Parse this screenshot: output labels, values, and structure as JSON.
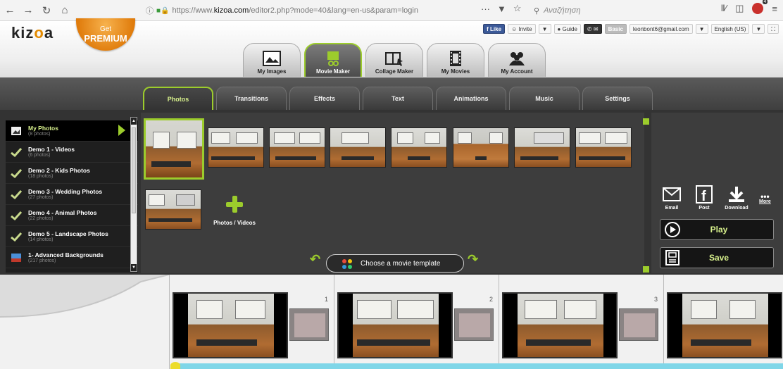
{
  "browser": {
    "url_prefix": "https://www.",
    "url_host": "kizoa.com",
    "url_path": "/editor2.php?mode=40&lang=en-us&param=login",
    "search_placeholder": "Αναζήτηση",
    "more_label": "···"
  },
  "header": {
    "logo_text_1": "kiz",
    "logo_text_2": "o",
    "logo_text_3": "a",
    "premium_line1": "Get",
    "premium_line2": "PREMIUM",
    "social": {
      "like": "Like",
      "invite": "Invite",
      "guide": "Guide",
      "plan": "Basic",
      "email": "leonbont6@gmail.com",
      "language": "English (US)"
    },
    "main_tabs": [
      {
        "label": "My Images"
      },
      {
        "label": "Movie Maker"
      },
      {
        "label": "Collage Maker"
      },
      {
        "label": "My Movies"
      },
      {
        "label": "My Account"
      }
    ]
  },
  "sub_tabs": [
    "Photos",
    "Transitions",
    "Effects",
    "Text",
    "Animations",
    "Music",
    "Settings"
  ],
  "albums": [
    {
      "name": "My Photos",
      "count": "(8 photos)"
    },
    {
      "name": "Demo 1 - Videos",
      "count": "(6 photos)"
    },
    {
      "name": "Demo 2 - Kids Photos",
      "count": "(18 photos)"
    },
    {
      "name": "Demo 3 - Wedding Photos",
      "count": "(27 photos)"
    },
    {
      "name": "Demo 4 - Animal Photos",
      "count": "(22 photos)"
    },
    {
      "name": "Demo 5 - Landscape Photos",
      "count": "(14 photos)"
    },
    {
      "name": "1- Advanced Backgrounds",
      "count": "(217 photos)"
    }
  ],
  "add_tile": {
    "label": "Photos / Videos"
  },
  "template_button": {
    "label": "Choose a movie template"
  },
  "share": {
    "email": "Email",
    "post": "Post",
    "download": "Download",
    "more": "More"
  },
  "actions": {
    "play": "Play",
    "save": "Save"
  },
  "timeline": {
    "slots": [
      "1",
      "2",
      "3"
    ]
  },
  "colors": {
    "accent": "#9ccc2c",
    "brand_orange": "#e07c0c",
    "panel": "#3d3d3d"
  }
}
